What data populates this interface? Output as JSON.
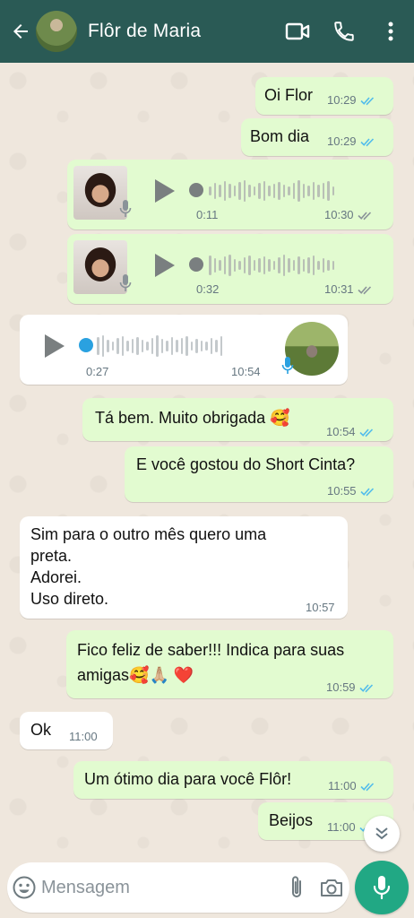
{
  "header": {
    "contact_name": "Flôr de Maria"
  },
  "messages": [
    {
      "type": "text",
      "direction": "out",
      "text": "Oi Flor",
      "time": "10:29",
      "status": "read"
    },
    {
      "type": "text",
      "direction": "out",
      "text": "Bom dia",
      "time": "10:29",
      "status": "read"
    },
    {
      "type": "voice",
      "direction": "out",
      "duration": "0:11",
      "time": "10:30",
      "status": "delivered"
    },
    {
      "type": "voice",
      "direction": "out",
      "duration": "0:32",
      "time": "10:31",
      "status": "delivered"
    },
    {
      "type": "voice",
      "direction": "in",
      "duration": "0:27",
      "time": "10:54"
    },
    {
      "type": "text",
      "direction": "out",
      "text": "Tá bem. Muito obrigada 🥰",
      "time": "10:54",
      "status": "read"
    },
    {
      "type": "text",
      "direction": "out",
      "text": "E você gostou do Short Cinta?",
      "time": "10:55",
      "status": "read"
    },
    {
      "type": "text",
      "direction": "in",
      "lines": [
        "Sim para o outro mês quero uma",
        "preta.",
        "Adorei.",
        "Uso direto."
      ],
      "time": "10:57"
    },
    {
      "type": "text",
      "direction": "out",
      "lines": [
        "Fico feliz de saber!!! Indica para suas",
        "amigas🥰🙏🏼 ❤️"
      ],
      "time": "10:59",
      "status": "read"
    },
    {
      "type": "text",
      "direction": "in",
      "text": "Ok",
      "time": "11:00"
    },
    {
      "type": "text",
      "direction": "out",
      "text": "Um ótimo dia para você Flôr!",
      "time": "11:00",
      "status": "read"
    },
    {
      "type": "text",
      "direction": "out",
      "text": "Beijos",
      "time": "11:00",
      "status": "read"
    }
  ],
  "composer": {
    "placeholder": "Mensagem"
  },
  "colors": {
    "header_bg": "#2a5a55",
    "outgoing_bubble": "#e2fbd0",
    "incoming_bubble": "#ffffff",
    "read_ticks": "#53bdeb",
    "accent_green": "#21a884"
  },
  "icons": {
    "header": [
      "back-arrow-icon",
      "video-call-icon",
      "phone-icon",
      "more-vertical-icon"
    ],
    "composer": [
      "emoji-icon",
      "attach-icon",
      "camera-icon",
      "mic-icon"
    ]
  }
}
